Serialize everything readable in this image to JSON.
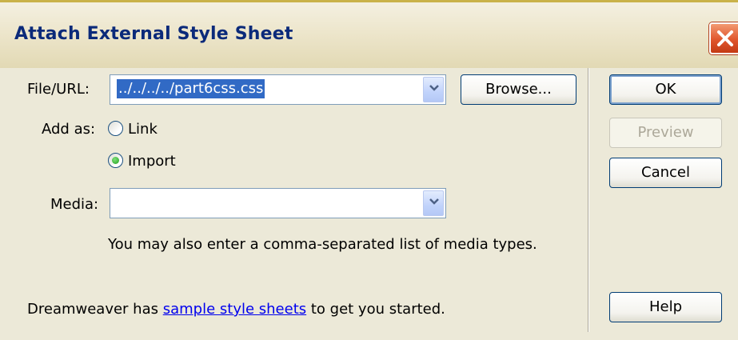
{
  "window": {
    "title": "Attach External Style Sheet"
  },
  "form": {
    "file_url_label": "File/URL:",
    "file_url_value": "../../../../part6css.css",
    "browse_label": "Browse...",
    "add_as_label": "Add as:",
    "options": [
      {
        "label": "Link",
        "selected": false
      },
      {
        "label": "Import",
        "selected": true
      }
    ],
    "media_label": "Media:",
    "media_value": "",
    "media_hint": "You may also enter a comma-separated list of media types."
  },
  "footer": {
    "prefix": "Dreamweaver has ",
    "link_text": "sample style sheets",
    "suffix": " to get you started."
  },
  "buttons": {
    "ok": "OK",
    "preview": "Preview",
    "cancel": "Cancel",
    "help": "Help"
  },
  "colors": {
    "title_text": "#0b2a7a",
    "selection": "#316ac5",
    "dialog_bg": "#ece9d8",
    "close": "#e0552c"
  }
}
